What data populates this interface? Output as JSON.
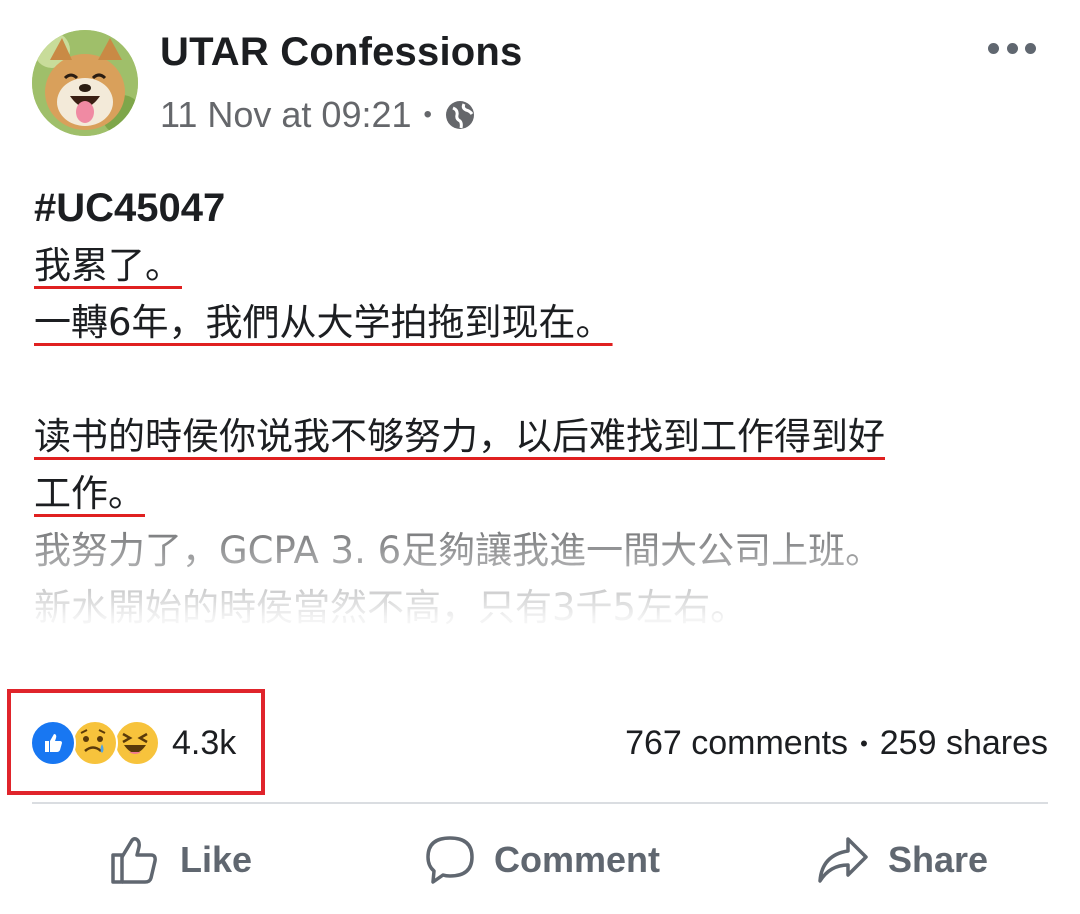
{
  "post": {
    "page_name": "UTAR Confessions",
    "timestamp": "11 Nov at 09:21",
    "privacy_icon": "globe-icon",
    "more_icon": "more-options-icon",
    "hashtag": "#UC45047",
    "lines": [
      "我累了。",
      "一轉6年，我們从大学拍拖到现在。",
      "读书的時侯你说我不够努力，以后难找到工作得到好",
      "工作。",
      "我努力了，GCPA 3. 6足夠讓我進一間大公司上班。",
      "新水開始的時侯當然不高，只有3千5左右。"
    ]
  },
  "engagement": {
    "reaction_icons": [
      "like-reaction-icon",
      "sad-reaction-icon",
      "haha-reaction-icon"
    ],
    "reaction_count": "4.3k",
    "comments": "767 comments",
    "shares": "259 shares"
  },
  "actions": {
    "like": "Like",
    "comment": "Comment",
    "share": "Share"
  },
  "colors": {
    "highlight_box": "#e0242b",
    "underline": "#e02020",
    "like_blue": "#1877f2"
  }
}
